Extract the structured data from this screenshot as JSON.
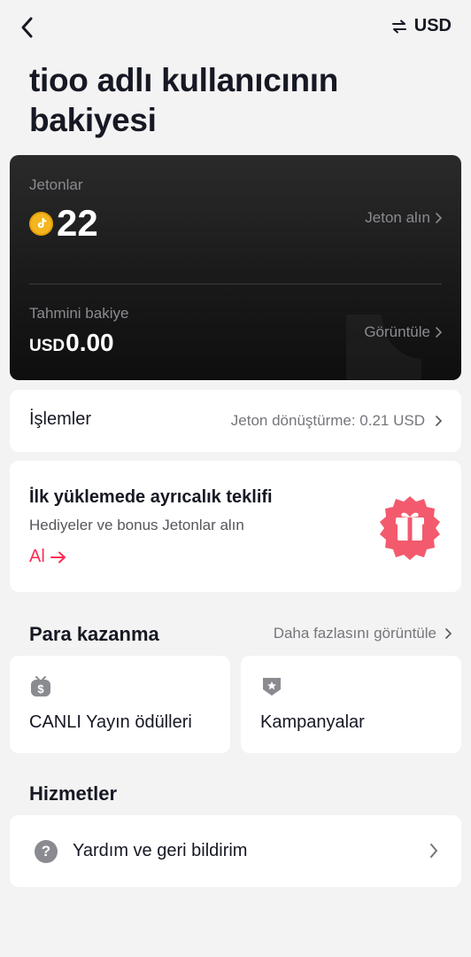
{
  "header": {
    "currency_label": "USD"
  },
  "page": {
    "title": "tioo adlı kullanıcının bakiyesi"
  },
  "balance_card": {
    "coins_label": "Jetonlar",
    "coins_value": "22",
    "buy_coins_label": "Jeton alın",
    "estimated_label": "Tahmini bakiye",
    "estimated_currency": "USD",
    "estimated_amount": "0.00",
    "view_label": "Görüntüle"
  },
  "transactions": {
    "title": "İşlemler",
    "conversion_text": "Jeton dönüştürme: 0.21 USD"
  },
  "offer": {
    "title": "İlk yüklemede ayrıcalık teklifi",
    "subtitle": "Hediyeler ve bonus Jetonlar alın",
    "cta_label": "Al"
  },
  "earn": {
    "title": "Para kazanma",
    "more_label": "Daha fazlasını görüntüle",
    "tiles": [
      {
        "label": "CANLI Yayın ödülleri",
        "icon": "live-rewards-icon"
      },
      {
        "label": "Kampanyalar",
        "icon": "campaign-badge-icon"
      }
    ]
  },
  "services": {
    "title": "Hizmetler",
    "items": [
      {
        "label": "Yardım ve geri bildirim",
        "icon": "help-icon"
      }
    ]
  },
  "colors": {
    "accent": "#fe2c55",
    "coin": "#f4b61d",
    "card_dark": "#1a1a1a"
  }
}
